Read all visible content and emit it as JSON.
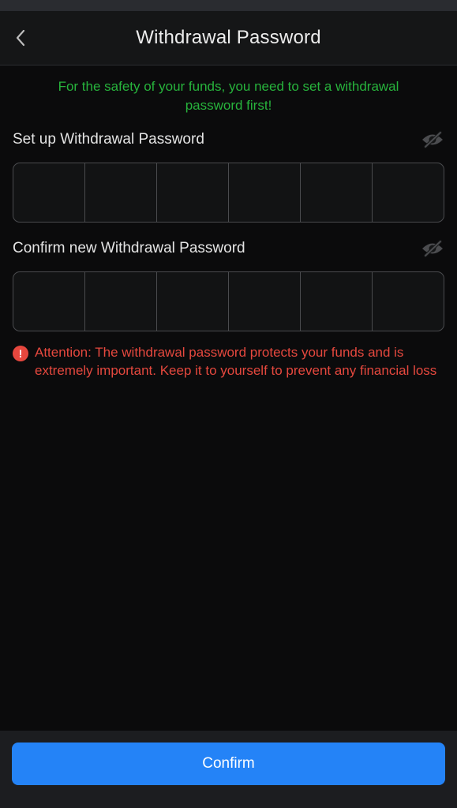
{
  "header": {
    "title": "Withdrawal Password",
    "back_icon": "chevron-left-icon"
  },
  "notice": {
    "text": "For the safety of your funds, you need to set a withdrawal password first!",
    "color": "#27b33c"
  },
  "setup_password": {
    "label": "Set up Withdrawal Password",
    "visibility_icon": "eye-off-icon",
    "digits": [
      "",
      "",
      "",
      "",
      "",
      ""
    ]
  },
  "confirm_password": {
    "label": "Confirm new Withdrawal Password",
    "visibility_icon": "eye-off-icon",
    "digits": [
      "",
      "",
      "",
      "",
      "",
      ""
    ]
  },
  "attention": {
    "icon": "exclamation-circle-icon",
    "glyph": "!",
    "text": "Attention: The withdrawal password protects your funds and is extremely important. Keep it to yourself to prevent any financial loss",
    "color": "#e5483e"
  },
  "footer": {
    "confirm_label": "Confirm",
    "button_color": "#2483f7"
  }
}
